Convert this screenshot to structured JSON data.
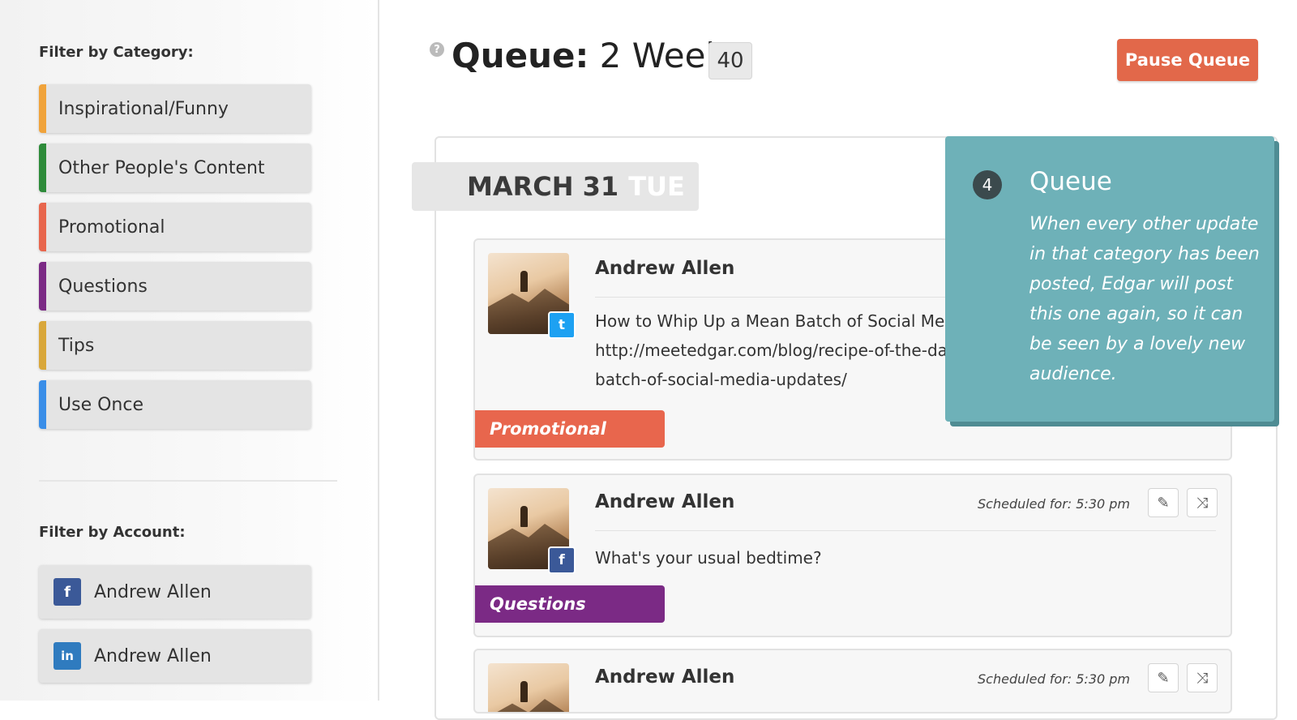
{
  "sidebar": {
    "category_heading": "Filter by Category:",
    "categories": [
      {
        "label": "Inspirational/Funny",
        "color": "#f0a33b"
      },
      {
        "label": "Other People's Content",
        "color": "#2e8b3a"
      },
      {
        "label": "Promotional",
        "color": "#e8664d"
      },
      {
        "label": "Questions",
        "color": "#7b2a85"
      },
      {
        "label": "Tips",
        "color": "#d9a73a"
      },
      {
        "label": "Use Once",
        "color": "#3a8ee8"
      }
    ],
    "account_heading": "Filter by Account:",
    "accounts": [
      {
        "label": "Andrew Allen",
        "network": "facebook",
        "icon": "f",
        "color": "#3b5998"
      },
      {
        "label": "Andrew Allen",
        "network": "linkedin",
        "icon": "in",
        "color": "#2f7bbf"
      }
    ]
  },
  "header": {
    "help_icon": "?",
    "title_bold": "Queue:",
    "title_rest": "2 Weeks",
    "count": "40",
    "pause_label": "Pause Queue"
  },
  "queue": {
    "date": "MARCH 31",
    "day": "TUE",
    "posts": [
      {
        "author": "Andrew Allen",
        "network": "twitter",
        "network_icon": "t",
        "text": "How to Whip Up a Mean Batch of Social Medi\nhttp://meetedgar.com/blog/recipe-of-the-day\nbatch-of-social-media-updates/",
        "category": "Promotional",
        "category_color": "#e8664d"
      },
      {
        "author": "Andrew Allen",
        "network": "facebook",
        "network_icon": "f",
        "scheduled": "Scheduled for: 5:30 pm",
        "text": "What's your usual bedtime?",
        "category": "Questions",
        "category_color": "#7b2a85"
      },
      {
        "author": "Andrew Allen",
        "scheduled": "Scheduled for: 5:30 pm"
      }
    ]
  },
  "tooltip": {
    "step": "4",
    "title": "Queue",
    "body": "When every other update in that category has been posted, Edgar will post this one again, so it can be seen by a lovely new audience."
  },
  "icons": {
    "edit": "✎",
    "shuffle": "⤨"
  },
  "colors": {
    "pause_button": "#e2684a",
    "tooltip_bg": "#6eb1b8",
    "twitter": "#1da1f2",
    "facebook": "#3b5998"
  }
}
